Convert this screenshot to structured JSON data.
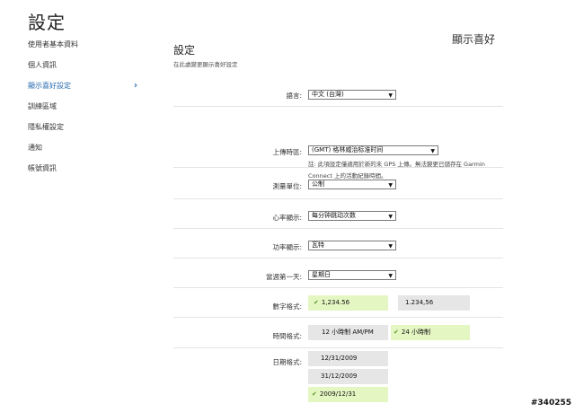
{
  "page": {
    "title": "設定"
  },
  "sidebar": {
    "items": [
      {
        "label": "使用者基本資料"
      },
      {
        "label": "個人資訊"
      },
      {
        "label": "顯示喜好設定",
        "active": true
      },
      {
        "label": "訓練區域"
      },
      {
        "label": "隱私權設定"
      },
      {
        "label": "通知"
      },
      {
        "label": "帳號資訊"
      }
    ],
    "active_indicator": "chevron-right-icon"
  },
  "main": {
    "section_heading": "顯示喜好",
    "title": "設定",
    "subtitle": "在此處變更顯示喜好設定"
  },
  "settings": {
    "language": {
      "label": "語言:",
      "value": "中文 (台灣)"
    },
    "timezone": {
      "label": "上傳時區:",
      "value": "(GMT) 格林威治标准时间",
      "note_line1": "註: 此項設定僅適用於新的未 GPS 上傳。無法變更已儲存在 Garmin",
      "note_line2": "Connect 上的活動紀錄時間。"
    },
    "units": {
      "label": "測量單位:",
      "value": "公制"
    },
    "heart_rate": {
      "label": "心率顯示:",
      "value": "每分钟跳动次数"
    },
    "power": {
      "label": "功率顯示:",
      "value": "瓦特"
    },
    "first_day": {
      "label": "當週第一天:",
      "value": "星期日"
    },
    "number_format": {
      "label": "數字格式:",
      "options": [
        {
          "text": "1,234.56",
          "selected": true
        },
        {
          "text": "1.234,56",
          "selected": false
        }
      ]
    },
    "time_format": {
      "label": "時間格式:",
      "options": [
        {
          "text": "12 小時制 AM/PM",
          "selected": false
        },
        {
          "text": "24 小時制",
          "selected": true
        }
      ]
    },
    "date_format": {
      "label": "日期格式:",
      "options": [
        {
          "text": "12/31/2009",
          "selected": false
        },
        {
          "text": "31/12/2009",
          "selected": false
        },
        {
          "text": "2009/12/31",
          "selected": true
        }
      ]
    }
  },
  "icons": {
    "check": "✔",
    "dropdown": "▼",
    "chevron": "›"
  },
  "colors": {
    "accent": "#2a6cb0",
    "selected_bg": "#e4f6c2",
    "option_bg": "#e6e6e6",
    "check": "#5a9a2a"
  },
  "watermark": "#340255"
}
